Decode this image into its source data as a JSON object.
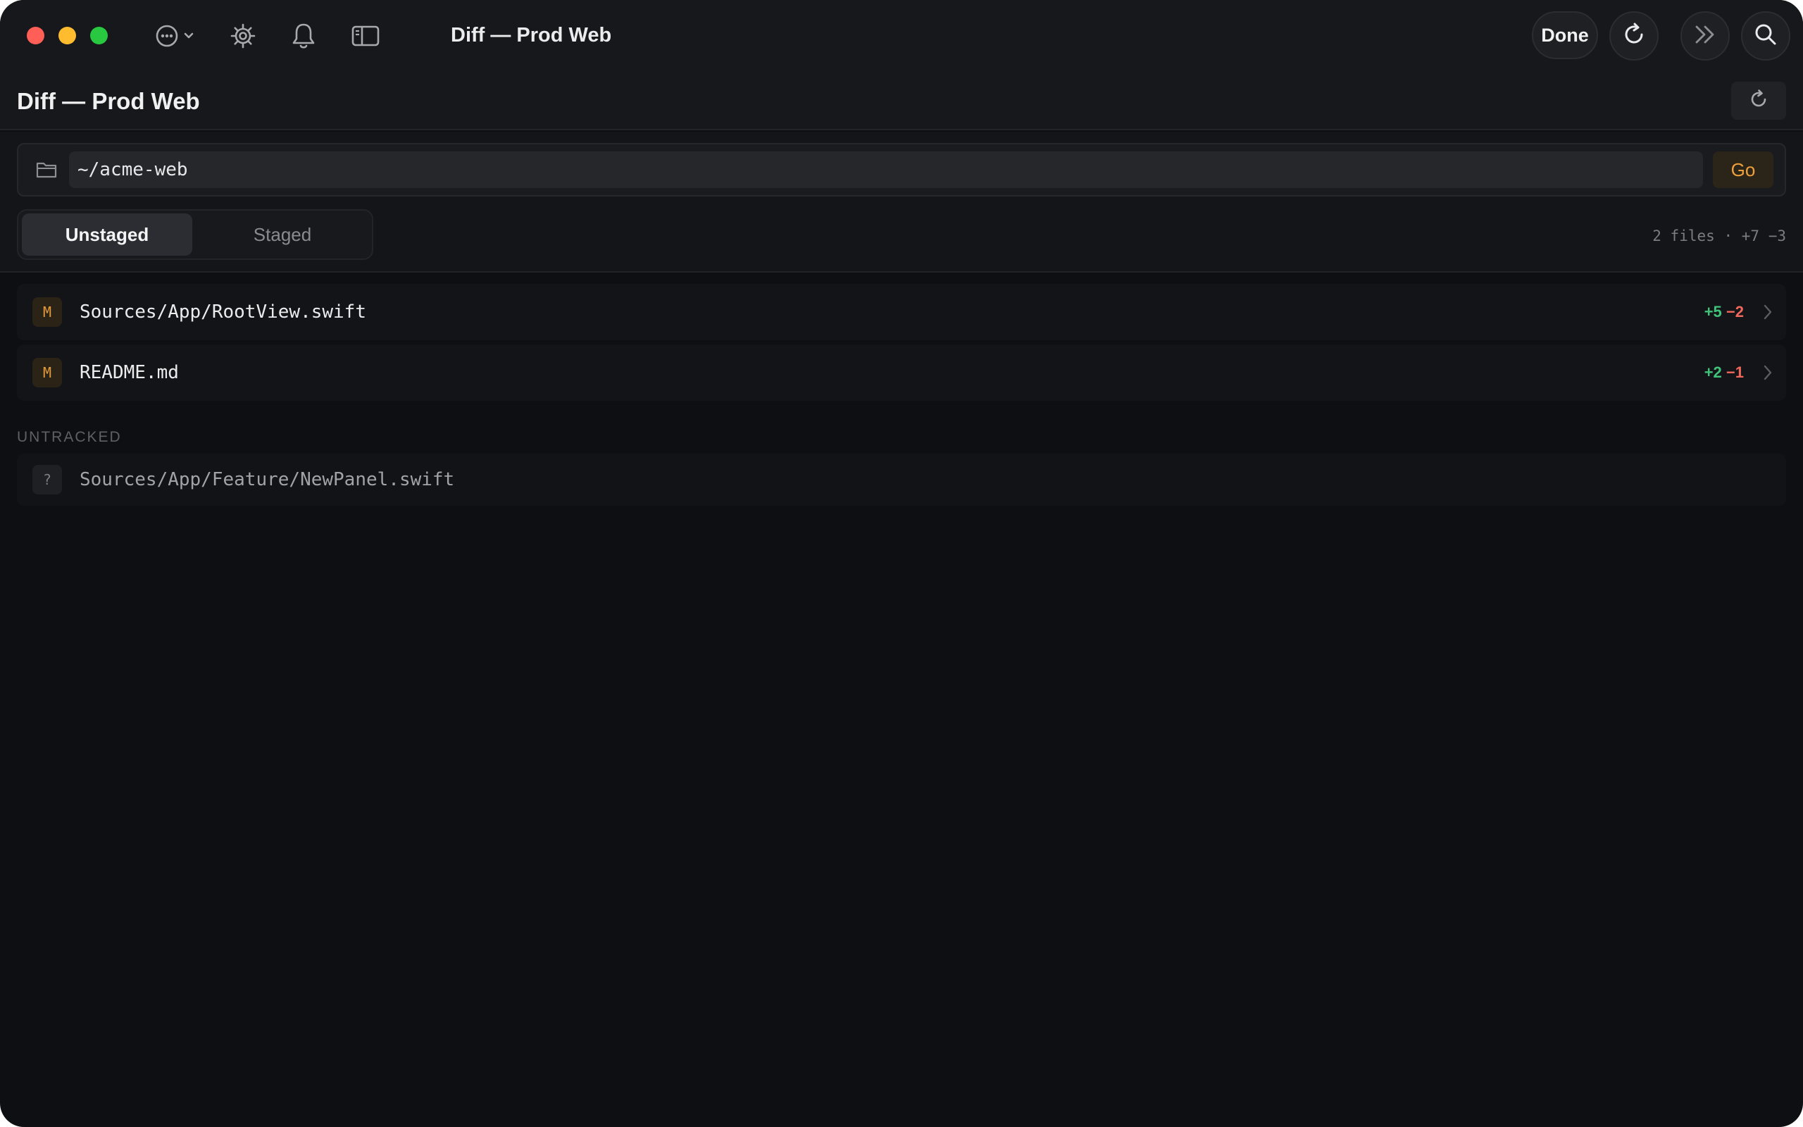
{
  "window": {
    "title": "Diff — Prod Web"
  },
  "toolbar": {
    "more_icon": "ellipsis-circle-icon",
    "settings_icon": "gear-icon",
    "notifications_icon": "bell-icon",
    "sidebar_icon": "sidebar-icon",
    "done_label": "Done",
    "refresh_icon": "refresh-icon",
    "forward_icon": "chevrons-right-icon",
    "search_icon": "search-icon"
  },
  "header": {
    "title": "Diff — Prod Web",
    "refresh_icon": "refresh-icon"
  },
  "path_bar": {
    "folder_icon": "folder-icon",
    "value": "~/acme-web",
    "go_label": "Go"
  },
  "tabs": [
    {
      "label": "Unstaged",
      "active": true
    },
    {
      "label": "Staged",
      "active": false
    }
  ],
  "summary": {
    "files": "2 files",
    "separator": "·",
    "additions": "+7",
    "deletions": "−3"
  },
  "changes": [
    {
      "status": "M",
      "path": "Sources/App/RootView.swift",
      "additions": "+5",
      "deletions": "−2"
    },
    {
      "status": "M",
      "path": "README.md",
      "additions": "+2",
      "deletions": "−1"
    }
  ],
  "untracked": {
    "heading": "UNTRACKED",
    "items": [
      {
        "status": "?",
        "path": "Sources/App/Feature/NewPanel.swift"
      }
    ]
  },
  "colors": {
    "background": "#0e0f12",
    "accent": "#f0a03a",
    "additions": "#3fc37a",
    "deletions": "#f0675c",
    "traffic_close": "#ff5f57",
    "traffic_minimize": "#febc2e",
    "traffic_zoom": "#28c840"
  }
}
